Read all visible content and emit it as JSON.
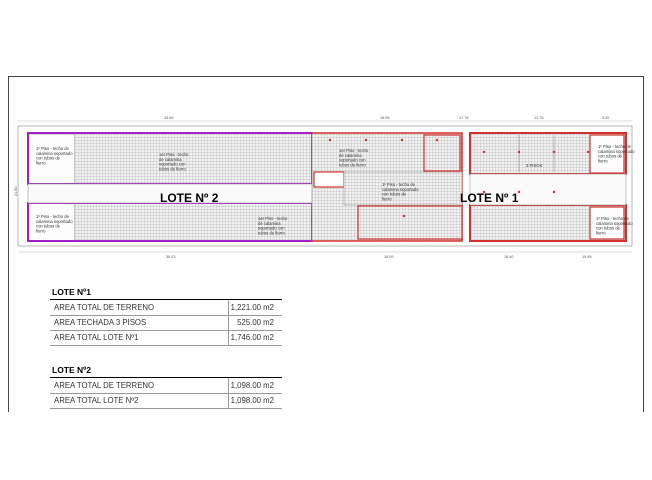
{
  "plan": {
    "lote1_label": "LOTE Nº 1",
    "lote2_label": "LOTE Nº 2",
    "notes": {
      "lote2_upper_left": "1º Piso - techo de calamina soportado con tubos de fierro",
      "lote2_lower_left": "1º Piso - techo de calamina soportado con tubos de fierro",
      "lote2_upper_center": "1er Piso - techo de calamina soportado con tubos de fierro",
      "lote2_lower_center": "1er Piso - techo de calamina soportado con tubos de fierro",
      "lote1_center_left": "1er Piso - techo de calamina soportado con tubos de fierro",
      "lote1_center": "1º Piso - techo de calamina soportado con tubos de fierro",
      "lote1_upper_right": "1º Piso - techo de calamina soportado con tubos de fierro",
      "lote1_lower_right": "1º Piso - techo de calamina soportado con tubos de fierro",
      "lote1_pisos": "3 PISOS"
    },
    "dimensions": {
      "top_lote2": "33.69",
      "top_lote1_a": "16.05",
      "top_lote1_b": "17.76",
      "top_lote1_c": "12.76",
      "top_lote1_d": "3.20",
      "bottom_lote2": "36.43",
      "bottom_lote1_a": "16.09",
      "bottom_lote1_b": "18.40",
      "bottom_lote1_c": "19.45",
      "left_height": "21.50"
    },
    "colors": {
      "lote1_outline": "#d0312d",
      "lote2_outline": "#a51fc7",
      "hatch": "#b0b0b0"
    }
  },
  "lote1_table": {
    "title": "LOTE Nº1",
    "rows": [
      {
        "label": "AREA TOTAL DE TERRENO",
        "value": "1,221.00 m2"
      },
      {
        "label": "AREA TECHADA 3 PISOS",
        "value": "525.00 m2"
      },
      {
        "label": "AREA TOTAL LOTE Nº1",
        "value": "1,746.00 m2"
      }
    ]
  },
  "lote2_table": {
    "title": "LOTE Nº2",
    "rows": [
      {
        "label": "AREA TOTAL DE TERRENO",
        "value": "1,098.00 m2"
      },
      {
        "label": "AREA TOTAL LOTE Nº2",
        "value": "1,098.00 m2"
      }
    ]
  }
}
